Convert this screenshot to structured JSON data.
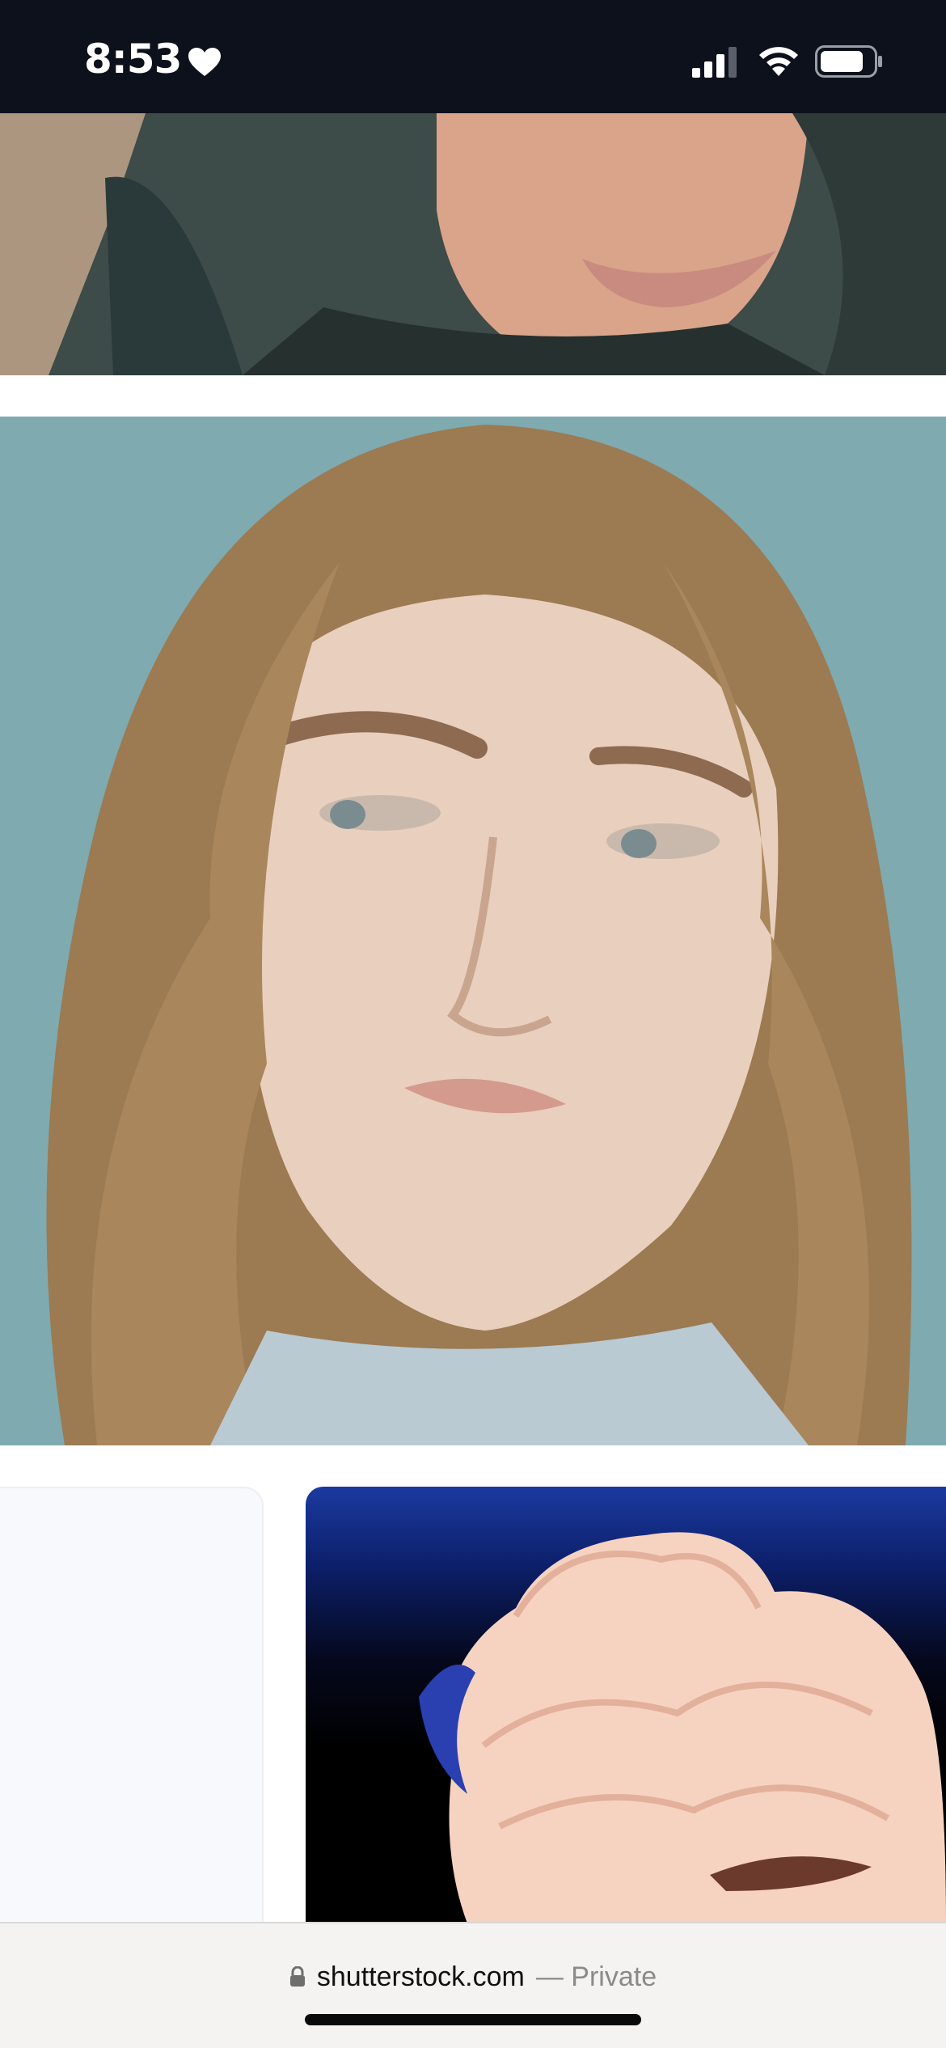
{
  "status_bar": {
    "time": "8:53",
    "icons": [
      "heart-icon",
      "signal-icon",
      "wifi-icon",
      "battery-icon"
    ]
  },
  "images": [
    {
      "name": "portrait-photo-partial",
      "description_icon": "photo"
    },
    {
      "name": "portrait-photo",
      "description_icon": "photo"
    },
    {
      "name": "placeholder-tile",
      "description_icon": "blank"
    },
    {
      "name": "illustration-tile",
      "description_icon": "illustration"
    }
  ],
  "browser": {
    "domain": "shutterstock.com",
    "private_label": "— Private",
    "lock_icon": "lock-icon"
  },
  "colors": {
    "status_bar_bg": "#0d111c",
    "bottom_bar_bg": "#f4f3f2",
    "private_text": "#8a8a8a"
  }
}
